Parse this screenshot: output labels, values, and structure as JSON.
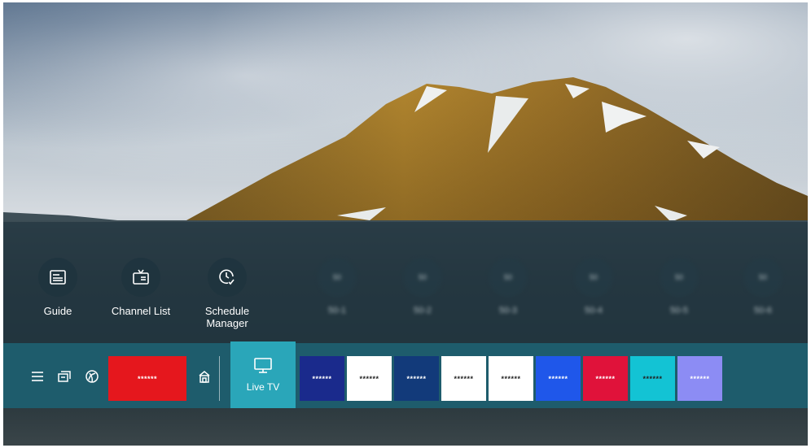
{
  "quick_menu": {
    "items": [
      {
        "label": "Guide",
        "icon": "guide-icon"
      },
      {
        "label": "Channel List",
        "icon": "channel-list-icon"
      },
      {
        "label": "Schedule Manager",
        "icon": "schedule-manager-icon"
      }
    ],
    "blurred_items": [
      {
        "badge": "50",
        "label": "50-1"
      },
      {
        "badge": "50",
        "label": "50-2"
      },
      {
        "badge": "50",
        "label": "50-3"
      },
      {
        "badge": "50",
        "label": "50-4"
      },
      {
        "badge": "50",
        "label": "50-5"
      },
      {
        "badge": "50",
        "label": "50-6"
      }
    ]
  },
  "launcher": {
    "menu_icon": "hamburger-menu-icon",
    "source_icon": "source-icon",
    "ambient_icon": "ambient-icon",
    "first_tile": {
      "text": "******",
      "color": "#e5171d"
    },
    "home_icon": "home-icon",
    "live_tv": {
      "label": "Live TV",
      "icon": "tv-icon",
      "color": "#2aa6b9"
    },
    "app_tiles": [
      {
        "text": "******",
        "bg": "#1a2a8c",
        "fg": "#ffffff"
      },
      {
        "text": "******",
        "bg": "#ffffff",
        "fg": "#222222"
      },
      {
        "text": "******",
        "bg": "#123a7a",
        "fg": "#ffffff"
      },
      {
        "text": "******",
        "bg": "#ffffff",
        "fg": "#222222"
      },
      {
        "text": "******",
        "bg": "#ffffff",
        "fg": "#222222"
      },
      {
        "text": "******",
        "bg": "#1f57ea",
        "fg": "#ffffff"
      },
      {
        "text": "******",
        "bg": "#e0123a",
        "fg": "#ffffff"
      },
      {
        "text": "******",
        "bg": "#13c3d4",
        "fg": "#222222"
      },
      {
        "text": "******",
        "bg": "#8c8cf4",
        "fg": "#ffffff"
      }
    ]
  },
  "colors": {
    "launcher_bg": "#1e5c6c",
    "accent": "#2aa6b9"
  }
}
